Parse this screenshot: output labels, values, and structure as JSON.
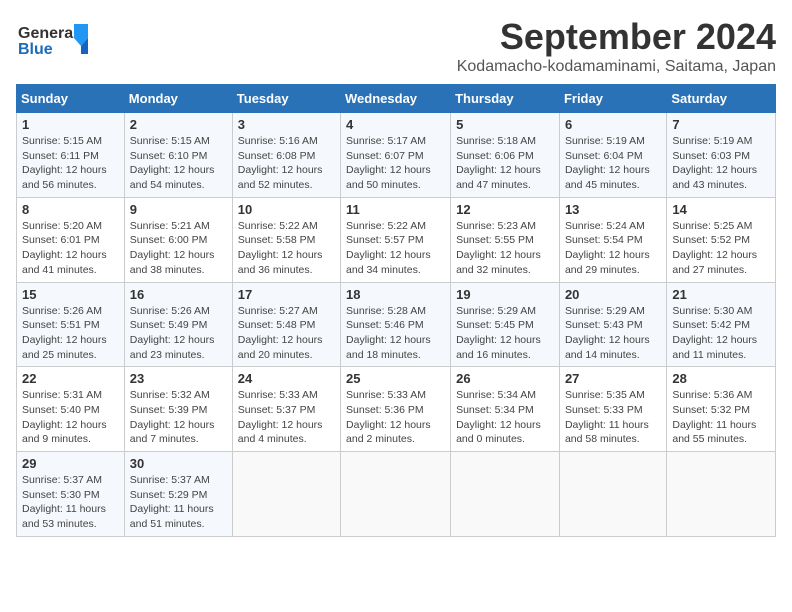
{
  "header": {
    "logo_text1": "General",
    "logo_text2": "Blue",
    "month_title": "September 2024",
    "location": "Kodamacho-kodamaminami, Saitama, Japan"
  },
  "weekdays": [
    "Sunday",
    "Monday",
    "Tuesday",
    "Wednesday",
    "Thursday",
    "Friday",
    "Saturday"
  ],
  "weeks": [
    [
      {
        "day": "1",
        "info": "Sunrise: 5:15 AM\nSunset: 6:11 PM\nDaylight: 12 hours\nand 56 minutes."
      },
      {
        "day": "2",
        "info": "Sunrise: 5:15 AM\nSunset: 6:10 PM\nDaylight: 12 hours\nand 54 minutes."
      },
      {
        "day": "3",
        "info": "Sunrise: 5:16 AM\nSunset: 6:08 PM\nDaylight: 12 hours\nand 52 minutes."
      },
      {
        "day": "4",
        "info": "Sunrise: 5:17 AM\nSunset: 6:07 PM\nDaylight: 12 hours\nand 50 minutes."
      },
      {
        "day": "5",
        "info": "Sunrise: 5:18 AM\nSunset: 6:06 PM\nDaylight: 12 hours\nand 47 minutes."
      },
      {
        "day": "6",
        "info": "Sunrise: 5:19 AM\nSunset: 6:04 PM\nDaylight: 12 hours\nand 45 minutes."
      },
      {
        "day": "7",
        "info": "Sunrise: 5:19 AM\nSunset: 6:03 PM\nDaylight: 12 hours\nand 43 minutes."
      }
    ],
    [
      {
        "day": "8",
        "info": "Sunrise: 5:20 AM\nSunset: 6:01 PM\nDaylight: 12 hours\nand 41 minutes."
      },
      {
        "day": "9",
        "info": "Sunrise: 5:21 AM\nSunset: 6:00 PM\nDaylight: 12 hours\nand 38 minutes."
      },
      {
        "day": "10",
        "info": "Sunrise: 5:22 AM\nSunset: 5:58 PM\nDaylight: 12 hours\nand 36 minutes."
      },
      {
        "day": "11",
        "info": "Sunrise: 5:22 AM\nSunset: 5:57 PM\nDaylight: 12 hours\nand 34 minutes."
      },
      {
        "day": "12",
        "info": "Sunrise: 5:23 AM\nSunset: 5:55 PM\nDaylight: 12 hours\nand 32 minutes."
      },
      {
        "day": "13",
        "info": "Sunrise: 5:24 AM\nSunset: 5:54 PM\nDaylight: 12 hours\nand 29 minutes."
      },
      {
        "day": "14",
        "info": "Sunrise: 5:25 AM\nSunset: 5:52 PM\nDaylight: 12 hours\nand 27 minutes."
      }
    ],
    [
      {
        "day": "15",
        "info": "Sunrise: 5:26 AM\nSunset: 5:51 PM\nDaylight: 12 hours\nand 25 minutes."
      },
      {
        "day": "16",
        "info": "Sunrise: 5:26 AM\nSunset: 5:49 PM\nDaylight: 12 hours\nand 23 minutes."
      },
      {
        "day": "17",
        "info": "Sunrise: 5:27 AM\nSunset: 5:48 PM\nDaylight: 12 hours\nand 20 minutes."
      },
      {
        "day": "18",
        "info": "Sunrise: 5:28 AM\nSunset: 5:46 PM\nDaylight: 12 hours\nand 18 minutes."
      },
      {
        "day": "19",
        "info": "Sunrise: 5:29 AM\nSunset: 5:45 PM\nDaylight: 12 hours\nand 16 minutes."
      },
      {
        "day": "20",
        "info": "Sunrise: 5:29 AM\nSunset: 5:43 PM\nDaylight: 12 hours\nand 14 minutes."
      },
      {
        "day": "21",
        "info": "Sunrise: 5:30 AM\nSunset: 5:42 PM\nDaylight: 12 hours\nand 11 minutes."
      }
    ],
    [
      {
        "day": "22",
        "info": "Sunrise: 5:31 AM\nSunset: 5:40 PM\nDaylight: 12 hours\nand 9 minutes."
      },
      {
        "day": "23",
        "info": "Sunrise: 5:32 AM\nSunset: 5:39 PM\nDaylight: 12 hours\nand 7 minutes."
      },
      {
        "day": "24",
        "info": "Sunrise: 5:33 AM\nSunset: 5:37 PM\nDaylight: 12 hours\nand 4 minutes."
      },
      {
        "day": "25",
        "info": "Sunrise: 5:33 AM\nSunset: 5:36 PM\nDaylight: 12 hours\nand 2 minutes."
      },
      {
        "day": "26",
        "info": "Sunrise: 5:34 AM\nSunset: 5:34 PM\nDaylight: 12 hours\nand 0 minutes."
      },
      {
        "day": "27",
        "info": "Sunrise: 5:35 AM\nSunset: 5:33 PM\nDaylight: 11 hours\nand 58 minutes."
      },
      {
        "day": "28",
        "info": "Sunrise: 5:36 AM\nSunset: 5:32 PM\nDaylight: 11 hours\nand 55 minutes."
      }
    ],
    [
      {
        "day": "29",
        "info": "Sunrise: 5:37 AM\nSunset: 5:30 PM\nDaylight: 11 hours\nand 53 minutes."
      },
      {
        "day": "30",
        "info": "Sunrise: 5:37 AM\nSunset: 5:29 PM\nDaylight: 11 hours\nand 51 minutes."
      },
      {
        "day": "",
        "info": ""
      },
      {
        "day": "",
        "info": ""
      },
      {
        "day": "",
        "info": ""
      },
      {
        "day": "",
        "info": ""
      },
      {
        "day": "",
        "info": ""
      }
    ]
  ]
}
